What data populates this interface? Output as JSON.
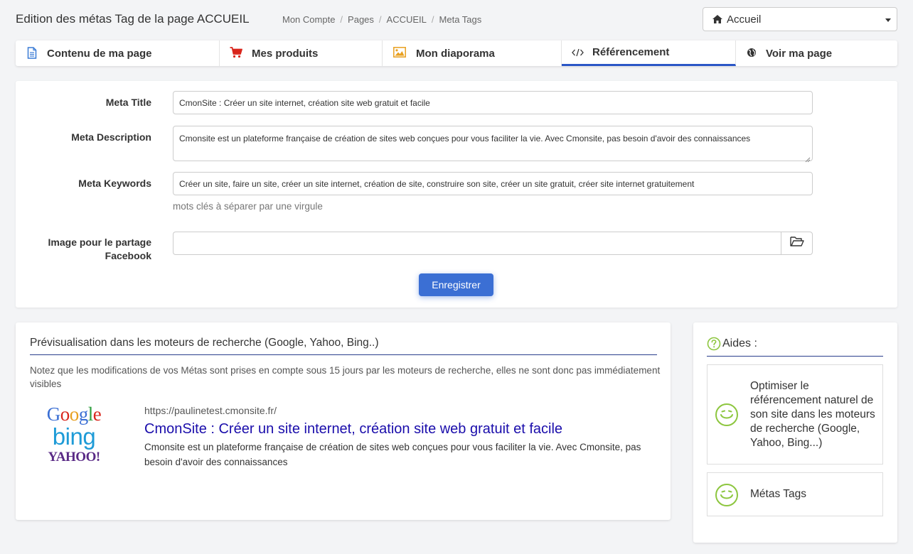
{
  "header": {
    "title": "Edition des métas Tag de la page ACCUEIL",
    "breadcrumb": [
      "Mon Compte",
      "Pages",
      "ACCUEIL",
      "Meta Tags"
    ],
    "breadcrumb_sep": "/",
    "page_select": {
      "value": "Accueil",
      "icon": "home-icon"
    }
  },
  "tabs": [
    {
      "label": "Contenu de ma page",
      "icon": "document-icon",
      "active": false
    },
    {
      "label": "Mes produits",
      "icon": "cart-icon",
      "active": false
    },
    {
      "label": "Mon diaporama",
      "icon": "image-icon",
      "active": false
    },
    {
      "label": "Référencement",
      "icon": "code-icon",
      "active": true
    },
    {
      "label": "Voir ma page",
      "icon": "globe-icon",
      "active": false
    }
  ],
  "form": {
    "meta_title": {
      "label": "Meta Title",
      "value": "CmonSite : Créer un site internet, création site web gratuit et facile"
    },
    "meta_description": {
      "label": "Meta Description",
      "value": "Cmonsite est un plateforme française de création de sites web conçues pour vous faciliter la vie. Avec Cmonsite, pas besoin d'avoir des connaissances"
    },
    "meta_keywords": {
      "label": "Meta Keywords",
      "value": "Créer un site, faire un site, créer un site internet, création de site, construire son site, créer un site gratuit, créer site internet gratuitement",
      "help": "mots clés à séparer par une virgule"
    },
    "facebook_image": {
      "label_line1": "Image pour le partage",
      "label_line2": "Facebook",
      "value": "",
      "button_icon": "folder-open-icon"
    },
    "save_label": "Enregistrer"
  },
  "preview": {
    "title": "Prévisualisation dans les moteurs de recherche (Google, Yahoo, Bing..)",
    "note": "Notez que les modifications de vos Métas sont prises en compte sous 15 jours par les moteurs de recherche, elles ne sont donc pas immédiatement visibles",
    "logos": {
      "google": "Google",
      "bing": "bing",
      "yahoo": "YAHOO!"
    },
    "serp": {
      "url": "https://paulinetest.cmonsite.fr/",
      "title": "CmonSite : Créer un site internet, création site web gratuit et facile",
      "description": "Cmonsite est un plateforme française de création de sites web conçues pour vous faciliter la vie. Avec Cmonsite, pas besoin d'avoir des connaissances"
    }
  },
  "help": {
    "title": "Aides :",
    "items": [
      {
        "label": "Optimiser le référencement naturel de son site dans les moteurs de recherche (Google, Yahoo, Bing...)",
        "icon": "smiley-icon"
      },
      {
        "label": "Métas Tags",
        "icon": "smiley-icon"
      }
    ]
  },
  "colors": {
    "accent": "#2a56c6",
    "button": "#3b6fd4",
    "serp_title": "#1a0dab",
    "help_icon": "#8dc63f",
    "cart_icon": "#d9261c",
    "image_icon": "#e8a020",
    "document_icon": "#3a7bd5"
  }
}
